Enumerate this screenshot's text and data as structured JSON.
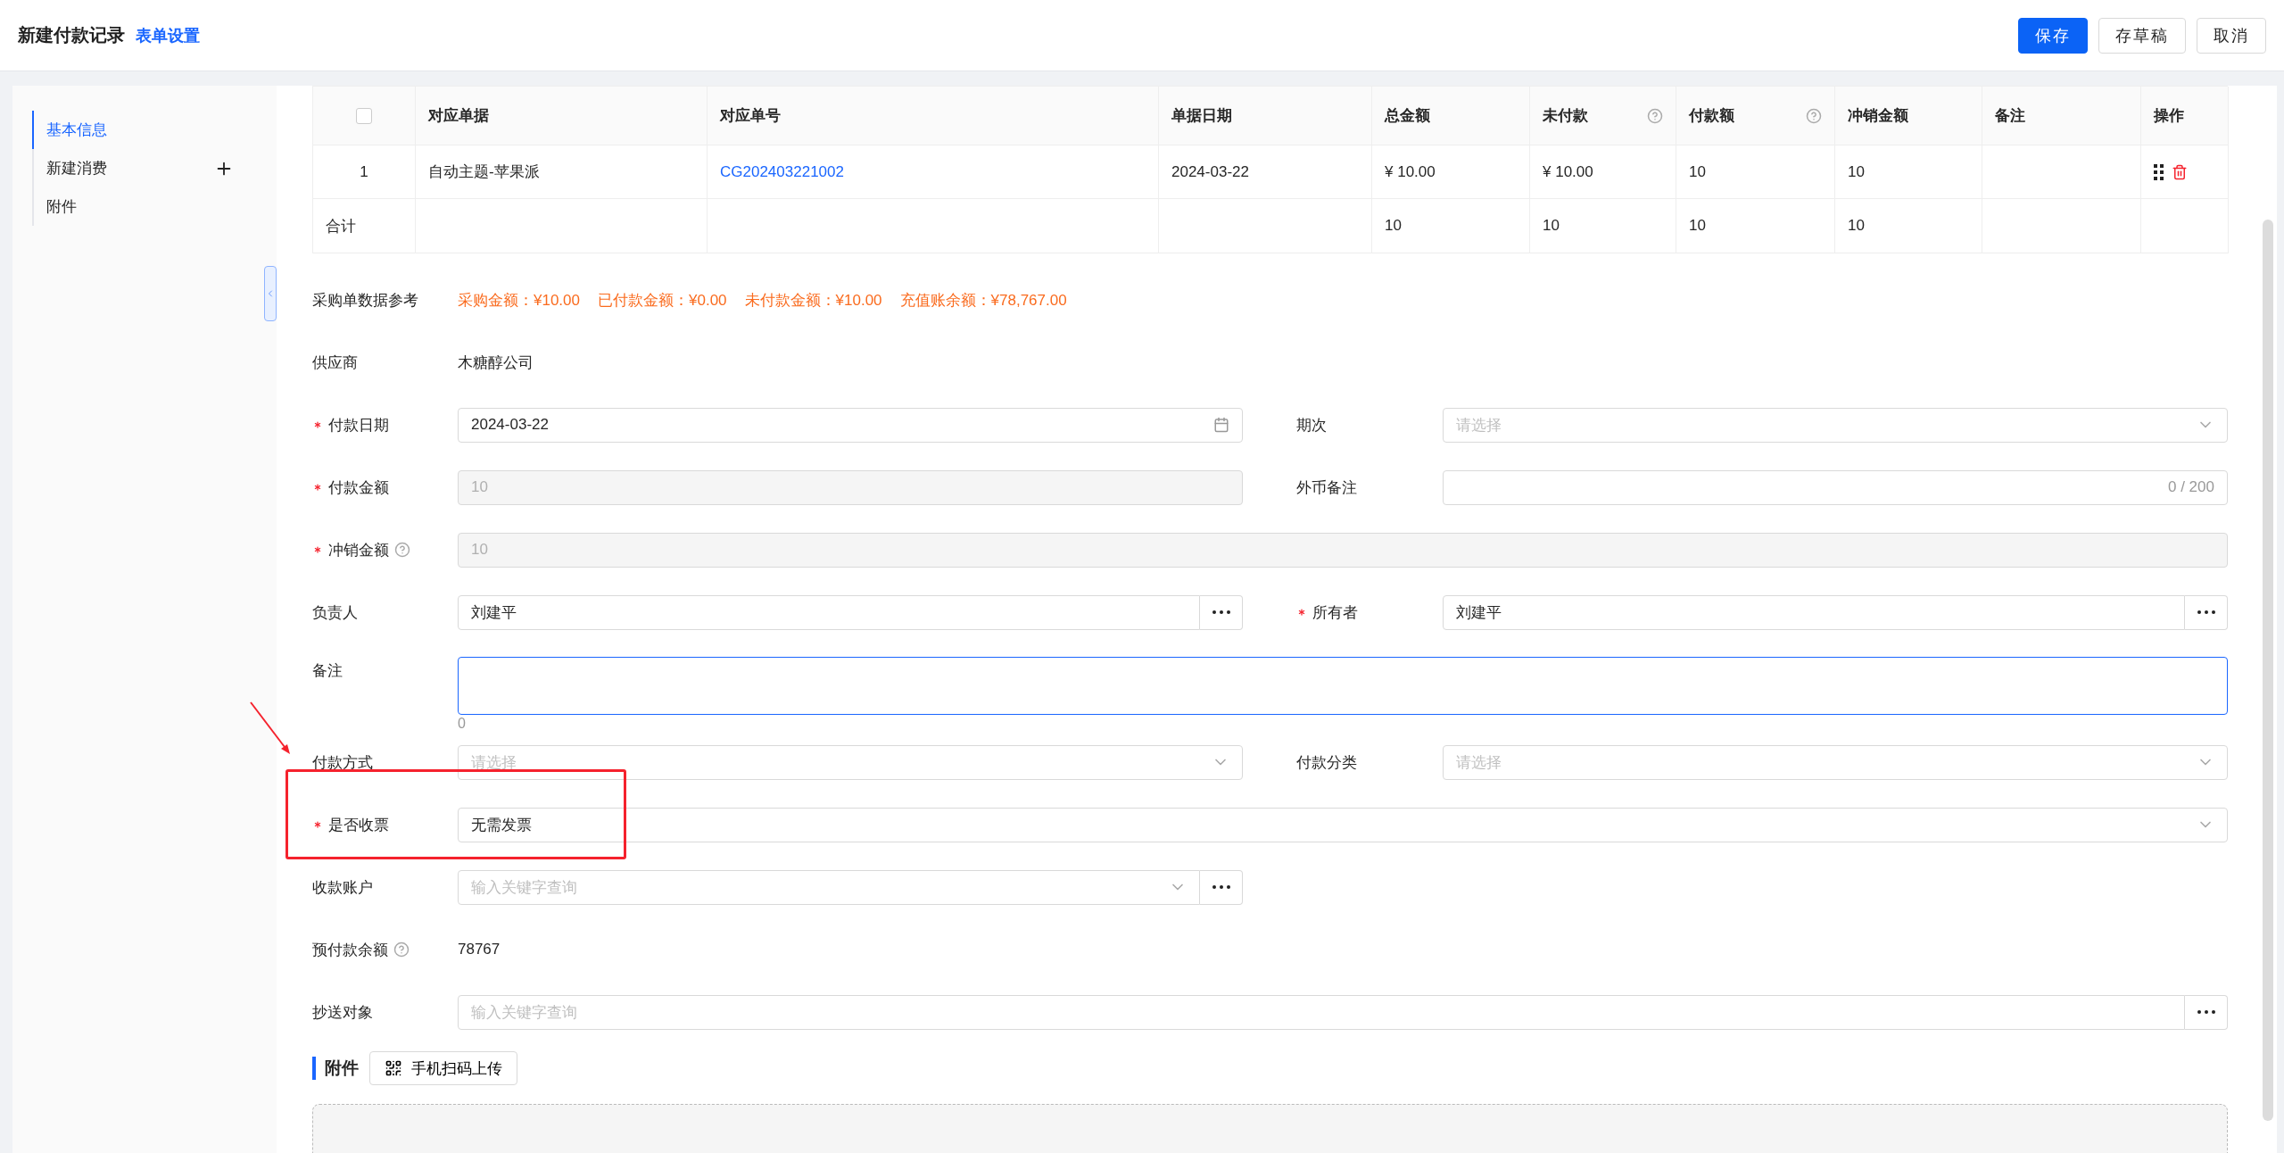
{
  "header": {
    "title": "新建付款记录",
    "settings_link": "表单设置",
    "buttons": [
      {
        "label": "保存",
        "kind": "primary"
      },
      {
        "label": "存草稿",
        "kind": "default"
      },
      {
        "label": "取消",
        "kind": "default"
      }
    ]
  },
  "sidebar": {
    "items": [
      {
        "label": "基本信息",
        "selected": true,
        "addable": false
      },
      {
        "label": "新建消费",
        "selected": false,
        "addable": true
      },
      {
        "label": "附件",
        "selected": false,
        "addable": false
      }
    ]
  },
  "table": {
    "select_all": {
      "checked": false
    },
    "columns": [
      {
        "label": "对应单据",
        "help": false
      },
      {
        "label": "对应单号",
        "help": false
      },
      {
        "label": "单据日期",
        "help": false
      },
      {
        "label": "总金额",
        "help": false
      },
      {
        "label": "未付款",
        "help": true
      },
      {
        "label": "付款额",
        "help": true
      },
      {
        "label": "冲销金额",
        "help": false
      },
      {
        "label": "备注",
        "help": false
      },
      {
        "label": "操作",
        "help": false
      }
    ],
    "rows": [
      {
        "index": "1",
        "cells": [
          {
            "kind": "text",
            "text": "自动主题-苹果派"
          },
          {
            "kind": "link",
            "text": "CG202403221002"
          },
          {
            "kind": "text",
            "text": "2024-03-22"
          },
          {
            "kind": "text",
            "text": "¥ 10.00"
          },
          {
            "kind": "text",
            "text": "¥ 10.00"
          },
          {
            "kind": "text",
            "text": "10"
          },
          {
            "kind": "text",
            "text": "10"
          },
          null,
          {
            "kind": "actions"
          }
        ]
      }
    ],
    "total": {
      "label": "合计",
      "cells": [
        null,
        null,
        null,
        "10",
        "10",
        "10",
        "10",
        null,
        null
      ]
    }
  },
  "form": {
    "rows": [
      [
        {
          "kind": "reference",
          "label": "采购单数据参考",
          "items": [
            "采购金额：¥10.00",
            "已付款金额：¥0.00",
            "未付款金额：¥10.00",
            "充值账余额：¥78,767.00"
          ]
        }
      ],
      [
        {
          "kind": "text",
          "label": "供应商",
          "value": "木糖醇公司"
        }
      ],
      [
        {
          "kind": "date",
          "label": "付款日期",
          "required": true,
          "value": "2024-03-22"
        },
        {
          "kind": "select",
          "label": "期次",
          "placeholder": "请选择"
        }
      ],
      [
        {
          "kind": "input",
          "label": "付款金额",
          "required": true,
          "disabled": true,
          "value": "10"
        },
        {
          "kind": "input",
          "label": "外币备注",
          "counter": "0 / 200"
        }
      ],
      [
        {
          "kind": "input",
          "label": "冲销金额",
          "required": true,
          "help": true,
          "disabled": true,
          "wide": true,
          "value": "10"
        }
      ],
      [
        {
          "kind": "lookup",
          "label": "负责人",
          "value": "刘建平"
        },
        {
          "kind": "lookup",
          "label": "所有者",
          "required": true,
          "value": "刘建平"
        }
      ],
      [
        {
          "kind": "textarea",
          "label": "备注",
          "wide": true,
          "focused": true,
          "counter": "0"
        }
      ],
      [
        {
          "kind": "select",
          "label": "付款方式",
          "placeholder": "请选择"
        },
        {
          "kind": "select",
          "label": "付款分类",
          "placeholder": "请选择"
        }
      ],
      [
        {
          "kind": "select",
          "label": "是否收票",
          "required": true,
          "wide": true,
          "value": "无需发票",
          "annotated": true
        }
      ],
      [
        {
          "kind": "lookup_select",
          "label": "收款账户",
          "placeholder": "输入关键字查询"
        }
      ],
      [
        {
          "kind": "text",
          "label": "预付款余额",
          "help": true,
          "value": "78767"
        }
      ],
      [
        {
          "kind": "lookup",
          "label": "抄送对象",
          "wide": true,
          "placeholder": "输入关键字查询"
        }
      ]
    ]
  },
  "attachments": {
    "title": "附件",
    "upload_button": "手机扫码上传"
  }
}
